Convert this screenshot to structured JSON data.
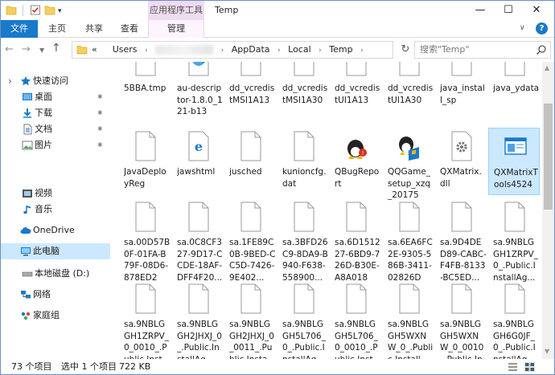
{
  "window": {
    "title": "Temp",
    "context_tab": "应用程序工具",
    "controls": {
      "minimize": "—",
      "maximize": "☐",
      "close": "✕"
    }
  },
  "ribbon": {
    "tabs": [
      "文件",
      "主页",
      "共享",
      "查看",
      "管理"
    ],
    "expand_icon": "chevron-down-icon",
    "help": "?"
  },
  "address": {
    "prefix": "«",
    "crumbs": [
      "Users",
      "AppData",
      "Local",
      "Temp"
    ],
    "search_placeholder": "搜索\"Temp\""
  },
  "sidebar": {
    "items": [
      {
        "label": "快速访问",
        "icon": "star-icon"
      },
      {
        "label": "桌面",
        "icon": "desktop-icon",
        "pinned": true
      },
      {
        "label": "下载",
        "icon": "download-icon",
        "pinned": true
      },
      {
        "label": "文档",
        "icon": "document-icon",
        "pinned": true
      },
      {
        "label": "图片",
        "icon": "pictures-icon",
        "pinned": true
      },
      {
        "label": "视频",
        "icon": "video-icon"
      },
      {
        "label": "音乐",
        "icon": "music-icon"
      },
      {
        "label": "OneDrive",
        "icon": "cloud-icon"
      },
      {
        "label": "此电脑",
        "icon": "computer-icon",
        "selected": true
      },
      {
        "label": "本地磁盘 (D:)",
        "icon": "drive-icon"
      },
      {
        "label": "网络",
        "icon": "network-icon"
      },
      {
        "label": "家庭组",
        "icon": "homegroup-icon"
      }
    ]
  },
  "files": {
    "rows": [
      [
        {
          "name": "5BBA.tmp",
          "type": "doc"
        },
        {
          "name": "au-descriptor-1.8.0_121-b13",
          "type": "web"
        },
        {
          "name": "dd_vcredistMSI1A13",
          "type": "doc"
        },
        {
          "name": "dd_vcredistMSI1A30",
          "type": "doc"
        },
        {
          "name": "dd_vcredistUI1A13",
          "type": "doc"
        },
        {
          "name": "dd_vcredistUI1A30",
          "type": "doc"
        },
        {
          "name": "java_install_sp",
          "type": "doc"
        },
        {
          "name": "java_ydata",
          "type": "doc"
        }
      ],
      [
        {
          "name": "JavaDeployReg",
          "type": "doc"
        },
        {
          "name": "jawshtml",
          "type": "ie"
        },
        {
          "name": "jusched",
          "type": "doc"
        },
        {
          "name": "kunioncfg.dat",
          "type": "doc"
        },
        {
          "name": "QBugReport",
          "type": "qbug"
        },
        {
          "name": "QQGame_setup_xzq_20175",
          "type": "qq"
        },
        {
          "name": "QXMatrix.dll",
          "type": "dll"
        },
        {
          "name": "QXMatrixTools4524",
          "type": "app",
          "selected": true
        }
      ],
      [
        {
          "name": "sa.00D57B0F-01FA-B79F-08D6-878ED20...",
          "type": "doc"
        },
        {
          "name": "sa.0C8CF327-9D17-CCDE-18AF-DFF4F20...",
          "type": "doc"
        },
        {
          "name": "sa.1FE89C0B-9BED-CC5D-7426-9E402...",
          "type": "doc"
        },
        {
          "name": "sa.3BFD26C9-8DA9-B940-F638-558900...",
          "type": "doc"
        },
        {
          "name": "sa.6D151227-6BD9-726D-B30E-A8A018D...",
          "type": "doc"
        },
        {
          "name": "sa.6EA6FC2E-9305-586B-3411-02826D1...",
          "type": "doc"
        },
        {
          "name": "sa.9D4DED89-CABC-F4FB-8133-BC5ED...",
          "type": "doc"
        },
        {
          "name": "sa.9NBLGGH1ZRPV_0_.Public.InstallAg...",
          "type": "doc"
        }
      ],
      [
        {
          "name": "sa.9NBLGGH1ZRPV_0_0010_.Public.Insta...",
          "type": "doc"
        },
        {
          "name": "sa.9NBLGGH2JHXJ_0_.Public.InstallAg...",
          "type": "doc"
        },
        {
          "name": "sa.9NBLGGH2JHXJ_0_0011_.Public.Insta...",
          "type": "doc"
        },
        {
          "name": "sa.9NBLGGH5L706_0_.Public.InstallAg...",
          "type": "doc"
        },
        {
          "name": "sa.9NBLGGH5L706_0_0010_.Public.Insta...",
          "type": "doc"
        },
        {
          "name": "sa.9NBLGGH5WXNW_0_.Public.Install...",
          "type": "doc"
        },
        {
          "name": "sa.9NBLGGH5WXNW_0_0010_.Public.Insta...",
          "type": "doc"
        },
        {
          "name": "sa.9NBLGGH6G0JF_0_.Public.InstallAg...",
          "type": "doc"
        }
      ]
    ]
  },
  "status": {
    "count": "73 个项目",
    "selected": "选中 1 个项目",
    "size": "722 KB"
  }
}
